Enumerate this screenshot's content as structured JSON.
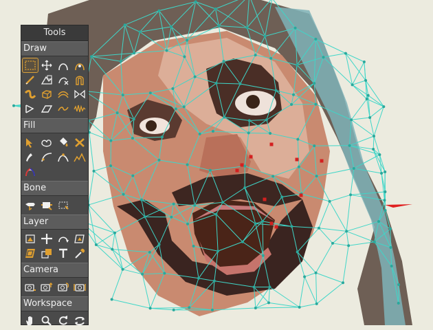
{
  "panel": {
    "title": "Tools",
    "sections": [
      {
        "label": "Draw",
        "tools": [
          "select-points-icon",
          "transform-points-icon",
          "add-point-icon",
          "curvature-icon",
          "freehand-icon",
          "blend-morphs-icon",
          "delete-edge-icon",
          "magnet-icon",
          "scatter-brush-icon",
          "shape-icon",
          "curve-profile-icon",
          "perspective-points-icon",
          "shear-points-icon",
          "bend-points-icon",
          "noise-icon",
          "magnet-wave-icon"
        ]
      },
      {
        "label": "Fill",
        "tools": [
          "select-shape-icon",
          "create-shape-icon",
          "paint-bucket-icon",
          "delete-shape-icon",
          "line-width-icon",
          "stroke-exposure-icon",
          "curve-exposure-icon",
          "curve-exposure-2-icon",
          "hide-edge-icon"
        ]
      },
      {
        "label": "Bone",
        "tools": [
          "select-bone-icon",
          "add-bone-icon",
          "reparent-bone-icon"
        ]
      },
      {
        "label": "Layer",
        "tools": [
          "transform-layer-icon",
          "set-origin-icon",
          "rotate-layer-icon",
          "shear-layer-icon",
          "perspective-layer-icon",
          "switch-layer-icon",
          "insert-text-icon",
          "eyedropper-icon"
        ]
      },
      {
        "label": "Camera",
        "tools": [
          "track-camera-icon",
          "zoom-camera-icon",
          "roll-camera-icon",
          "pan-tilt-camera-icon"
        ]
      },
      {
        "label": "Workspace",
        "tools": [
          "hand-pan-icon",
          "zoom-icon",
          "rotate-workspace-icon",
          "orbit-workspace-icon"
        ]
      }
    ]
  },
  "colors": {
    "panel_bg": "#4a4a4a",
    "icon_accent": "#e0a030",
    "mesh_line": "#3fd6c8",
    "mesh_point": "#2aa89c",
    "selected_point": "#d42020"
  }
}
